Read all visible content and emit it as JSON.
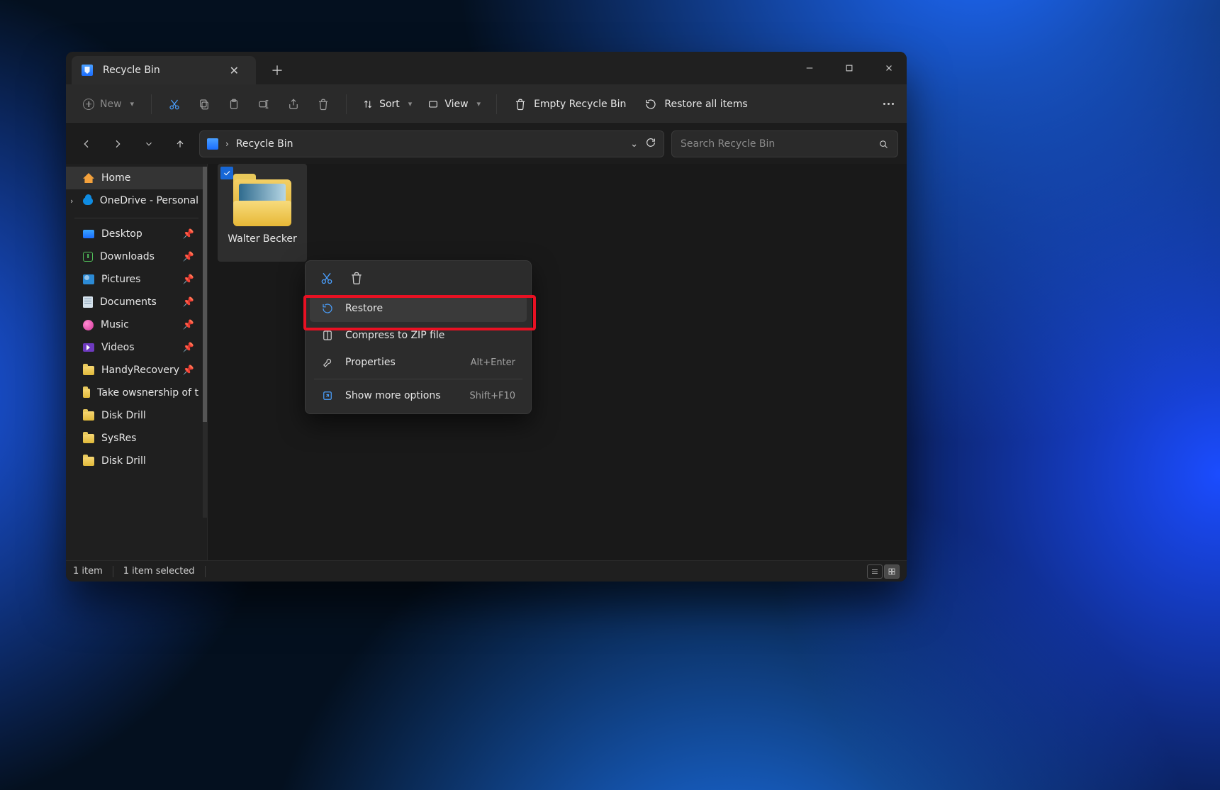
{
  "window": {
    "tab_title": "Recycle Bin"
  },
  "toolbar": {
    "new_label": "New",
    "sort_label": "Sort",
    "view_label": "View",
    "empty_label": "Empty Recycle Bin",
    "restore_all_label": "Restore all items"
  },
  "address": {
    "crumb": "Recycle Bin"
  },
  "search": {
    "placeholder": "Search Recycle Bin"
  },
  "sidebar": {
    "home": "Home",
    "onedrive": "OneDrive - Personal",
    "items": [
      {
        "label": "Desktop",
        "pinned": true
      },
      {
        "label": "Downloads",
        "pinned": true
      },
      {
        "label": "Pictures",
        "pinned": true
      },
      {
        "label": "Documents",
        "pinned": true
      },
      {
        "label": "Music",
        "pinned": true
      },
      {
        "label": "Videos",
        "pinned": true
      },
      {
        "label": "HandyRecovery",
        "pinned": true
      },
      {
        "label": "Take owsnership of t",
        "pinned": false
      },
      {
        "label": "Disk Drill",
        "pinned": false
      },
      {
        "label": "SysRes",
        "pinned": false
      },
      {
        "label": "Disk Drill",
        "pinned": false
      }
    ]
  },
  "content": {
    "tile_label": "Walter Becker"
  },
  "context": {
    "restore": "Restore",
    "compress": "Compress to ZIP file",
    "properties": "Properties",
    "properties_hk": "Alt+Enter",
    "show_more": "Show more options",
    "show_more_hk": "Shift+F10"
  },
  "status": {
    "count": "1 item",
    "selected": "1 item selected"
  }
}
